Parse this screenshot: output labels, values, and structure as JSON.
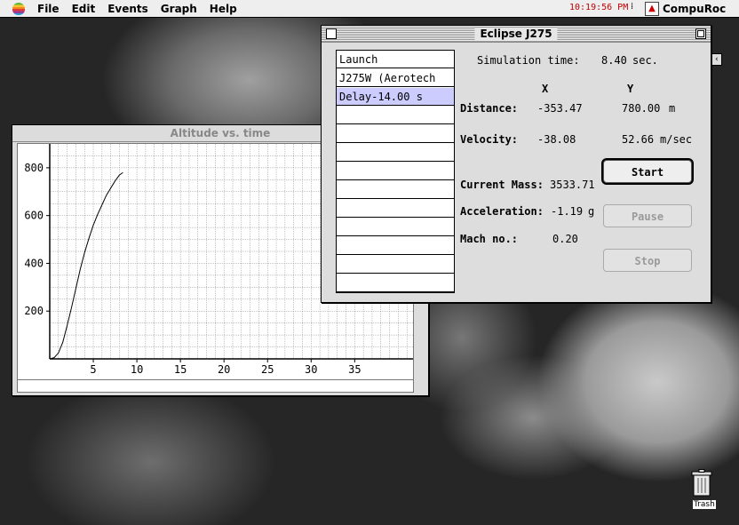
{
  "menubar": {
    "items": [
      "File",
      "Edit",
      "Events",
      "Graph",
      "Help"
    ],
    "clock": "10:19:56 PM",
    "app_name": "CompuRoc"
  },
  "graph_window": {
    "title": "Altitude vs. time",
    "chart_data": {
      "type": "line",
      "x_ticks": [
        "5",
        "10",
        "15",
        "20",
        "25",
        "30",
        "35"
      ],
      "y_ticks": [
        "200",
        "400",
        "600",
        "800"
      ],
      "xlim": [
        0,
        42
      ],
      "ylim": [
        0,
        900
      ],
      "grid": true,
      "series": [
        {
          "x": [
            0,
            0.5,
            1,
            1.5,
            2,
            2.5,
            3,
            3.5,
            4,
            4.5,
            5,
            5.5,
            6,
            6.5,
            7,
            7.5,
            8,
            8.4
          ],
          "y": [
            0,
            5,
            25,
            70,
            140,
            215,
            295,
            375,
            445,
            505,
            560,
            605,
            645,
            685,
            715,
            745,
            770,
            780
          ]
        }
      ]
    }
  },
  "sim_window": {
    "title": "Eclipse J275",
    "events": [
      "Launch",
      "J275W (Aerotech",
      "Delay-14.00 s",
      "",
      "",
      "",
      "",
      "",
      "",
      "",
      "",
      "",
      ""
    ],
    "selected_index": 2,
    "sim_time_label": "Simulation time:",
    "sim_time_value": "8.40",
    "sim_time_unit": "sec.",
    "col_x": "X",
    "col_y": "Y",
    "distance_label": "Distance:",
    "distance_x": "-353.47",
    "distance_y": "780.00",
    "distance_unit": "m",
    "velocity_label": "Velocity:",
    "velocity_x": "-38.08",
    "velocity_y": "52.66",
    "velocity_unit": "m/sec",
    "mass_label": "Current Mass:",
    "mass_value": "3533.71",
    "accel_label": "Acceleration:",
    "accel_value": "-1.19",
    "accel_unit": "g",
    "mach_label": "Mach no.:",
    "mach_value": "0.20",
    "start_label": "Start",
    "pause_label": "Pause",
    "stop_label": "Stop"
  },
  "desktop": {
    "trash_label": "Trash"
  }
}
